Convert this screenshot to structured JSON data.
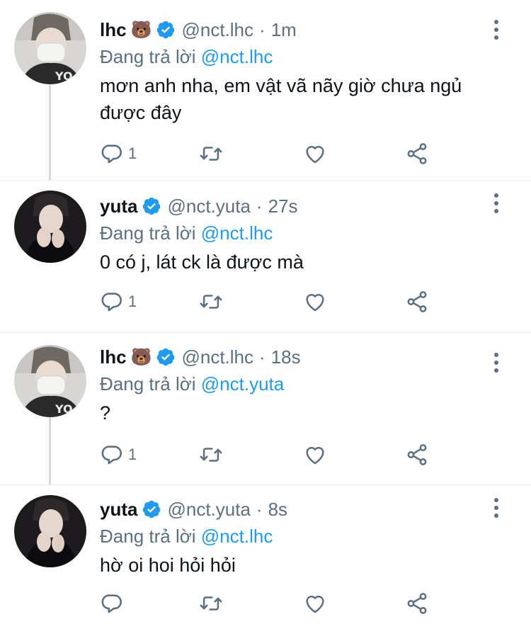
{
  "colors": {
    "text": "#0f1419",
    "muted": "#5b7083",
    "accent": "#1d9bf0",
    "divider": "#e6ecf0"
  },
  "tweets": [
    {
      "name": "lhc",
      "emoji": "🐻",
      "handle": "@nct.lhc",
      "dot": "·",
      "time": "1m",
      "replying_prefix": "Đang trả lời ",
      "replying_to": "@nct.lhc",
      "text": "mơn anh nha, em vật vã nãy giờ chưa ngủ được đây",
      "reply_count": "1"
    },
    {
      "name": "yuta",
      "handle": "@nct.yuta",
      "dot": "·",
      "time": "27s",
      "replying_prefix": "Đang trả lời ",
      "replying_to": "@nct.lhc",
      "text": "0 có j, lát ck là được mà",
      "reply_count": "1"
    },
    {
      "name": "lhc",
      "emoji": "🐻",
      "handle": "@nct.lhc",
      "dot": "·",
      "time": "18s",
      "replying_prefix": "Đang trả lời ",
      "replying_to": "@nct.yuta",
      "text": "?",
      "reply_count": "1"
    },
    {
      "name": "yuta",
      "handle": "@nct.yuta",
      "dot": "·",
      "time": "8s",
      "replying_prefix": "Đang trả lời ",
      "replying_to": "@nct.lhc",
      "text": "hờ oi hoi hỏi hỏi",
      "reply_count": ""
    }
  ],
  "icons": {
    "verified": "verified-badge-icon",
    "reply": "reply-icon",
    "retweet": "retweet-icon",
    "like": "heart-icon",
    "share": "share-icon",
    "more": "more-vertical-icon"
  }
}
